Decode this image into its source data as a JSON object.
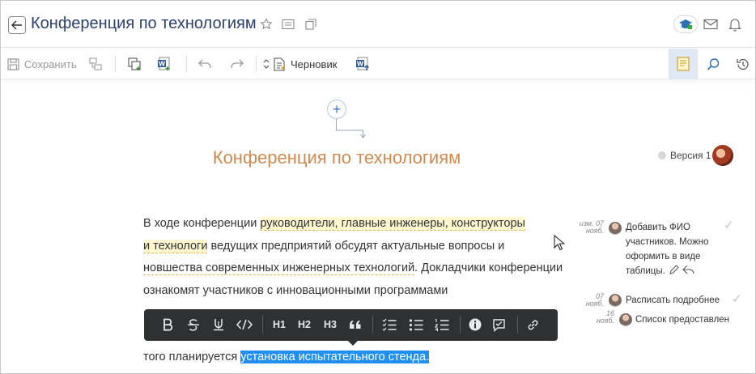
{
  "header": {
    "title": "Конференция по технологиям"
  },
  "toolbar": {
    "save_label": "Сохранить",
    "status_label": "Черновик"
  },
  "document": {
    "heading": "Конференция по технологиям",
    "version_label": "Версия 1",
    "paragraph": {
      "p1": "В ходе конференции ",
      "h1": "руководители, главные инженеры, конструкторы",
      "h2": "и технологи",
      "p2": " ведущих предприятий обсудят актуальные вопросы и ",
      "u1": "новшества современных инженерных технологий",
      "p3": ". Докладчики конференции ознакомят участников с инновационными программами",
      "p4": "того планируется ",
      "selected": "установка испытательного стенда."
    }
  },
  "comments": [
    {
      "date1": "изм. 07",
      "date2": "нояб.",
      "text": "Добавить ФИО участников. Можно оформить в виде таблицы."
    },
    {
      "date1": "07",
      "date2": "нояб.",
      "text": "Расписать подробнее"
    },
    {
      "date1": "16",
      "date2": "нояб.",
      "text": "Список предоставлен"
    }
  ],
  "format_bar": {
    "h1": "H1",
    "h2": "H2",
    "h3": "H3"
  },
  "colors": {
    "title": "#2a3f6b",
    "heading": "#d08a4f",
    "highlight": "#fdf6cf",
    "selection": "#1f8ff1",
    "format_bar_bg": "#2f3032"
  }
}
